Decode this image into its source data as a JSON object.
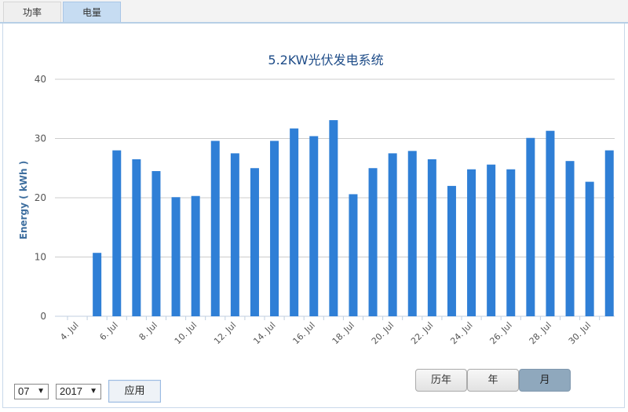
{
  "tabs": [
    {
      "label": "功率",
      "active": false
    },
    {
      "label": "电量",
      "active": true
    }
  ],
  "controls": {
    "month_value": "07",
    "year_value": "2017",
    "apply_label": "应用"
  },
  "period_buttons": [
    {
      "label": "历年",
      "active": false
    },
    {
      "label": "年",
      "active": false
    },
    {
      "label": "月",
      "active": true
    }
  ],
  "colors": {
    "bar": "#2f7fd6",
    "title": "#1e4c88",
    "ylabel": "#3f6f9f",
    "tab_active": "#c6dcf2"
  },
  "chart_data": {
    "type": "bar",
    "title": "5.2KW光伏发电系统",
    "ylabel": "Energy ( kWh )",
    "xlabel": "",
    "ylim": [
      0,
      40
    ],
    "yticks": [
      0,
      10,
      20,
      30,
      40
    ],
    "grid": true,
    "categories": [
      "4. Jul",
      "5. Jul",
      "6. Jul",
      "7. Jul",
      "8. Jul",
      "9. Jul",
      "10. Jul",
      "11. Jul",
      "12. Jul",
      "13. Jul",
      "14. Jul",
      "15. Jul",
      "16. Jul",
      "17. Jul",
      "18. Jul",
      "19. Jul",
      "20. Jul",
      "21. Jul",
      "22. Jul",
      "23. Jul",
      "24. Jul",
      "25. Jul",
      "26. Jul",
      "27. Jul",
      "28. Jul",
      "29. Jul",
      "30. Jul",
      "31. Jul"
    ],
    "tick_labels": [
      "4. Jul",
      "6. Jul",
      "8. Jul",
      "10. Jul",
      "12. Jul",
      "14. Jul",
      "16. Jul",
      "18. Jul",
      "20. Jul",
      "22. Jul",
      "24. Jul",
      "26. Jul",
      "28. Jul",
      "30. Jul"
    ],
    "values": [
      null,
      10.7,
      28.0,
      26.5,
      24.5,
      20.1,
      20.3,
      29.6,
      27.5,
      25.0,
      29.6,
      31.7,
      30.4,
      33.1,
      20.6,
      25.0,
      27.5,
      27.9,
      26.5,
      22.0,
      24.8,
      25.6,
      24.8,
      30.1,
      31.3,
      26.2,
      22.7,
      28.0
    ]
  }
}
